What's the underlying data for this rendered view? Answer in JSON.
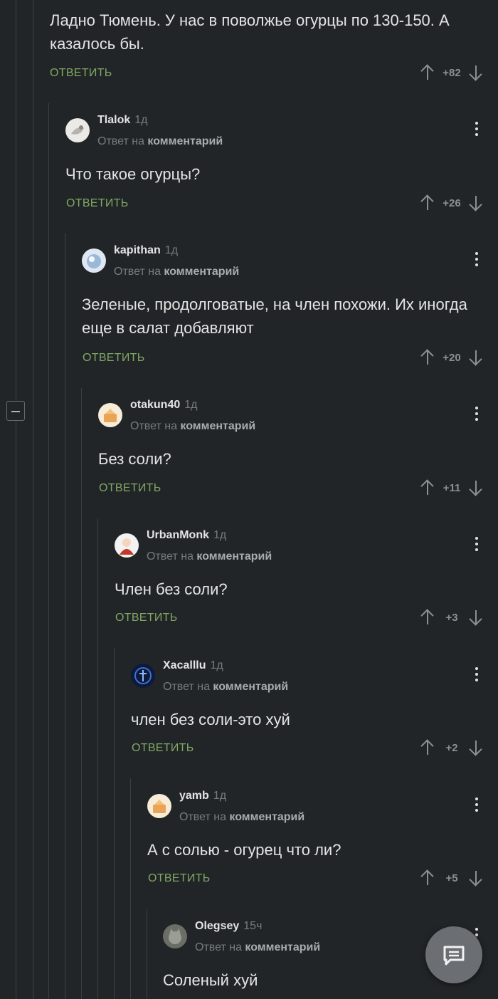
{
  "top_comment": {
    "text": "Ладно Тюмень. У нас в поволжье огурцы по 130-150. А казалось бы.",
    "reply_label": "ОТВЕТИТЬ",
    "score": "+82"
  },
  "comments": [
    {
      "username": "Tlalok",
      "time": "1д",
      "reply_prefix": "Ответ на",
      "reply_target": "комментарий",
      "text": "Что такое огурцы?",
      "reply_label": "ОТВЕТИТЬ",
      "score": "+26"
    },
    {
      "username": "kapithan",
      "time": "1д",
      "reply_prefix": "Ответ на",
      "reply_target": "комментарий",
      "text": "Зеленые, продолговатые, на член похожи. Их иногда еще в салат добавляют",
      "reply_label": "ОТВЕТИТЬ",
      "score": "+20"
    },
    {
      "username": "otakun40",
      "time": "1д",
      "reply_prefix": "Ответ на",
      "reply_target": "комментарий",
      "text": "Без соли?",
      "reply_label": "ОТВЕТИТЬ",
      "score": "+11"
    },
    {
      "username": "UrbanMonk",
      "time": "1д",
      "reply_prefix": "Ответ на",
      "reply_target": "комментарий",
      "text": "Член без соли?",
      "reply_label": "ОТВЕТИТЬ",
      "score": "+3"
    },
    {
      "username": "Xacalllu",
      "time": "1д",
      "reply_prefix": "Ответ на",
      "reply_target": "комментарий",
      "text": "член без соли-это хуй",
      "reply_label": "ОТВЕТИТЬ",
      "score": "+2"
    },
    {
      "username": "yamb",
      "time": "1д",
      "reply_prefix": "Ответ на",
      "reply_target": "комментарий",
      "text": "А с солью - огурец что ли?",
      "reply_label": "ОТВЕТИТЬ",
      "score": "+5"
    },
    {
      "username": "Olegsey",
      "time": "15ч",
      "reply_prefix": "Ответ на",
      "reply_target": "комментарий",
      "text": "Соленый хуй"
    }
  ],
  "colors": {
    "background": "#222528",
    "reply_link": "#7fa863",
    "muted": "#777b80"
  },
  "icons": {
    "upvote": "arrow-up-icon",
    "downvote": "arrow-down-icon",
    "menu": "more-vertical-icon",
    "fab": "comment-icon",
    "collapse": "minus-icon"
  }
}
